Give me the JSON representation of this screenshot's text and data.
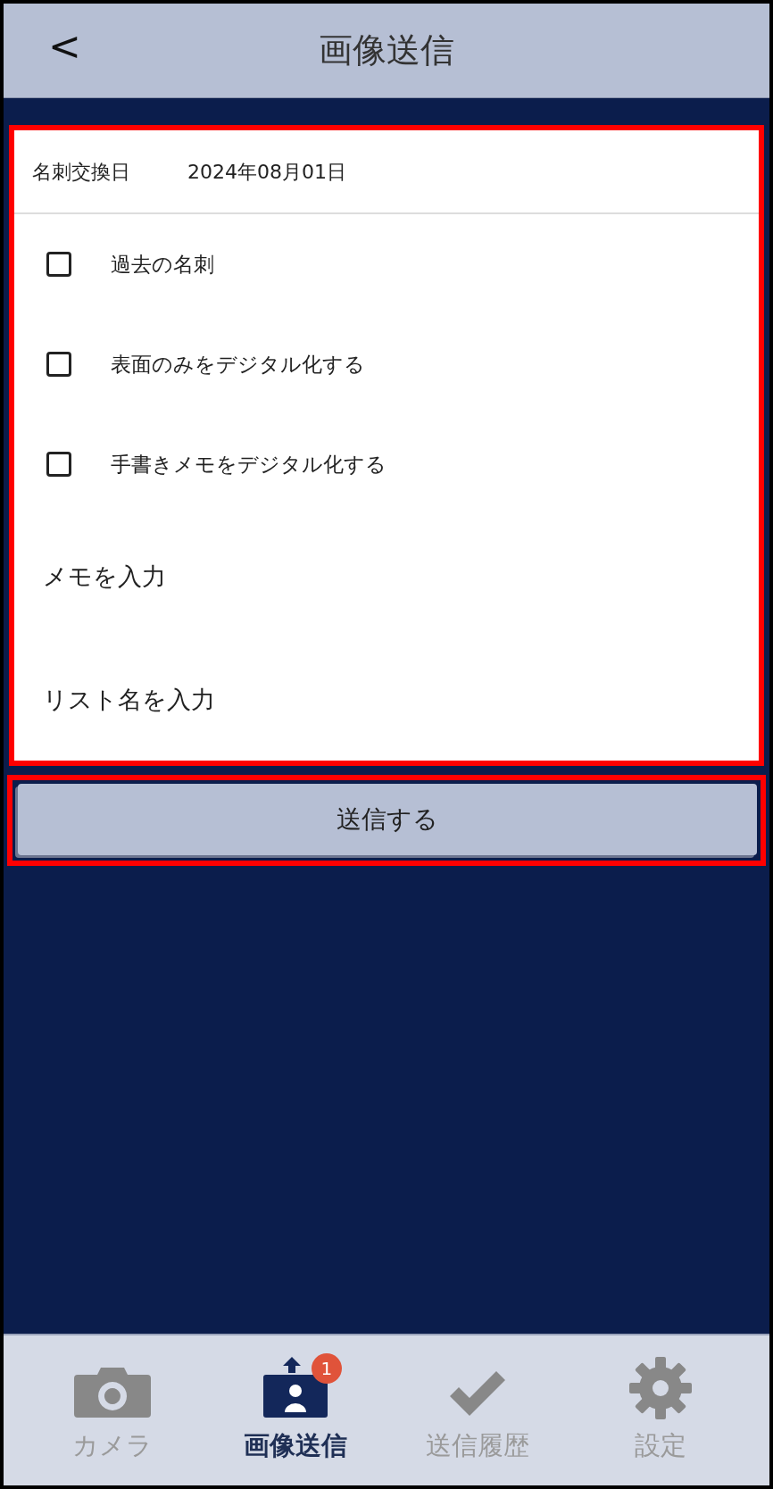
{
  "header": {
    "back": "<",
    "title": "画像送信"
  },
  "form": {
    "highlighted": true,
    "date": {
      "label": "名刺交換日",
      "value": "2024年08月01日"
    },
    "options": [
      {
        "label": "過去の名刺",
        "checked": false
      },
      {
        "label": "表面のみをデジタル化する",
        "checked": false
      },
      {
        "label": "手書きメモをデジタル化する",
        "checked": false
      }
    ],
    "fields": [
      {
        "placeholder": "メモを入力"
      },
      {
        "placeholder": "リスト名を入力"
      }
    ]
  },
  "submit": {
    "label": "送信する",
    "highlighted": true
  },
  "tab_bar": [
    {
      "kind": "camera",
      "label": "カメラ",
      "selected": false
    },
    {
      "kind": "upload",
      "label": "画像送信",
      "selected": true,
      "badge": "1"
    },
    {
      "kind": "check",
      "label": "送信履歴",
      "selected": false
    },
    {
      "kind": "gear",
      "label": "設定",
      "selected": false
    }
  ]
}
